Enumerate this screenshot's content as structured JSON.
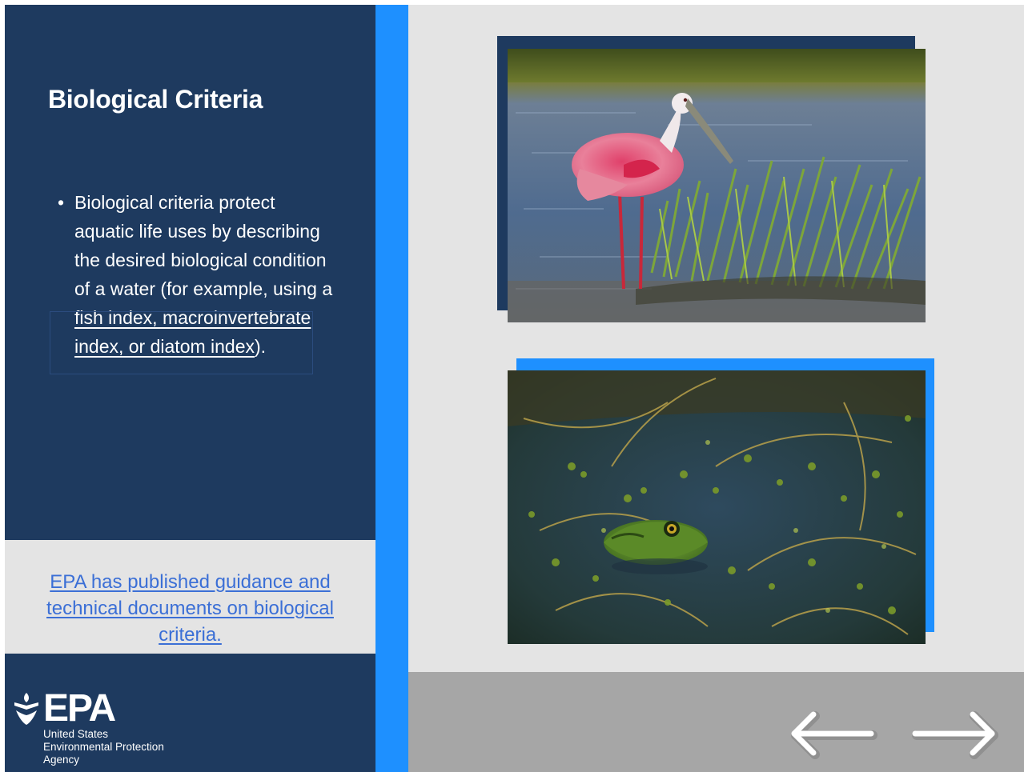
{
  "slide": {
    "title": "Biological Criteria",
    "bullet_symbol": "•",
    "bullet_text": "Biological criteria protect aquatic life uses by describing the desired biological condition of a water (for example, using a ",
    "bullet_link_text": "fish index, macroinvertebrate index, or diatom index",
    "bullet_suffix": ")."
  },
  "resource_link": {
    "text": "EPA has published guidance and technical documents on biological criteria."
  },
  "logo": {
    "wordmark": "EPA",
    "agency_name": "United States\nEnvironmental Protection\nAgency"
  },
  "images": [
    {
      "subject": "roseate spoonbill wading in marsh water"
    },
    {
      "subject": "green frog among aquatic plants in pond"
    }
  ],
  "navigation": {
    "prev_icon": "arrow-left-icon",
    "next_icon": "arrow-right-icon"
  },
  "colors": {
    "panel_navy": "#1e3a5f",
    "accent_blue": "#1e90ff",
    "link_blue": "#3b6fd6",
    "background_gray": "#e4e4e4",
    "nav_bar_gray": "#a6a6a6"
  }
}
